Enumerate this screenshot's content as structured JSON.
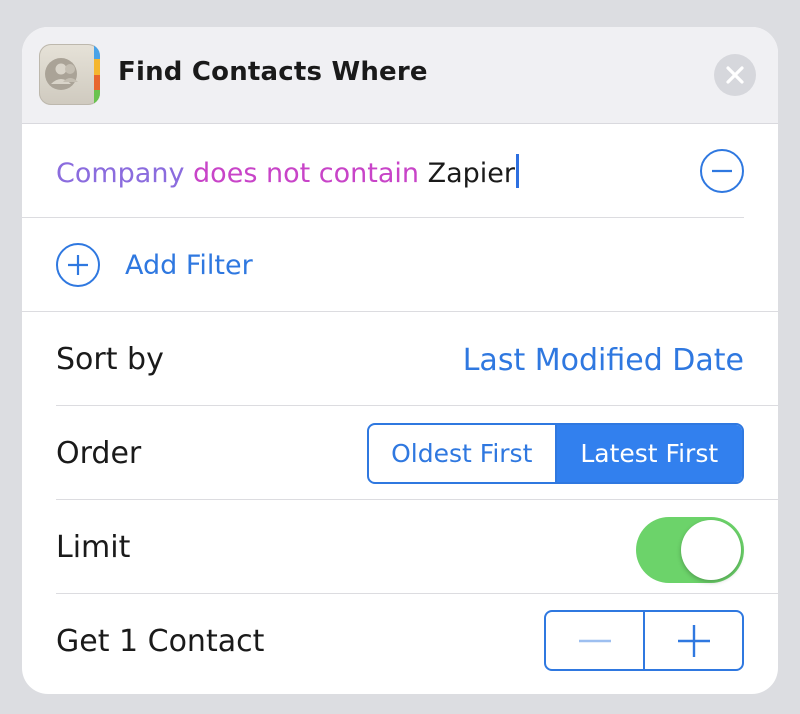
{
  "header": {
    "title": "Find Contacts Where",
    "app_icon": "contacts-app-icon",
    "close_icon": "close-icon"
  },
  "filter": {
    "field": "Company",
    "operator": "does not contain",
    "value": "Zapier",
    "remove_icon": "minus-circle-icon"
  },
  "add_filter": {
    "label": "Add Filter",
    "icon": "plus-circle-icon"
  },
  "sort": {
    "label": "Sort by",
    "value": "Last Modified Date"
  },
  "order": {
    "label": "Order",
    "options": [
      "Oldest First",
      "Latest First"
    ],
    "selected": "Latest First"
  },
  "limit": {
    "label": "Limit",
    "enabled": true
  },
  "get_count": {
    "label": "Get 1 Contact",
    "decrement_icon": "minus-icon",
    "increment_icon": "plus-icon"
  },
  "colors": {
    "accent": "#2f78e0",
    "field": "#8b6cde",
    "operator": "#c844c8",
    "toggle_on": "#6cd36a",
    "header_bg": "#f0f0f3"
  }
}
